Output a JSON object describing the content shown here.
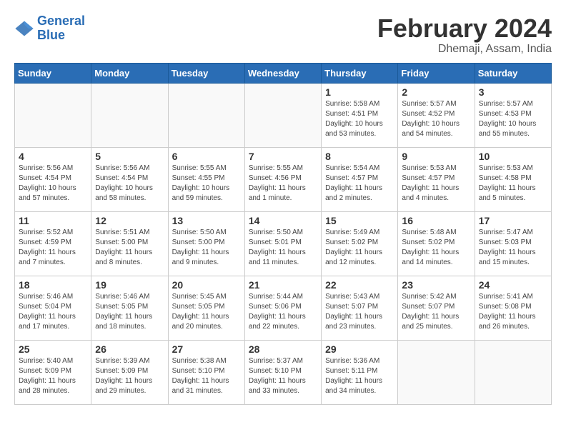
{
  "header": {
    "logo_line1": "General",
    "logo_line2": "Blue",
    "title": "February 2024",
    "subtitle": "Dhemaji, Assam, India"
  },
  "days_of_week": [
    "Sunday",
    "Monday",
    "Tuesday",
    "Wednesday",
    "Thursday",
    "Friday",
    "Saturday"
  ],
  "weeks": [
    [
      {
        "day": "",
        "info": ""
      },
      {
        "day": "",
        "info": ""
      },
      {
        "day": "",
        "info": ""
      },
      {
        "day": "",
        "info": ""
      },
      {
        "day": "1",
        "info": "Sunrise: 5:58 AM\nSunset: 4:51 PM\nDaylight: 10 hours\nand 53 minutes."
      },
      {
        "day": "2",
        "info": "Sunrise: 5:57 AM\nSunset: 4:52 PM\nDaylight: 10 hours\nand 54 minutes."
      },
      {
        "day": "3",
        "info": "Sunrise: 5:57 AM\nSunset: 4:53 PM\nDaylight: 10 hours\nand 55 minutes."
      }
    ],
    [
      {
        "day": "4",
        "info": "Sunrise: 5:56 AM\nSunset: 4:54 PM\nDaylight: 10 hours\nand 57 minutes."
      },
      {
        "day": "5",
        "info": "Sunrise: 5:56 AM\nSunset: 4:54 PM\nDaylight: 10 hours\nand 58 minutes."
      },
      {
        "day": "6",
        "info": "Sunrise: 5:55 AM\nSunset: 4:55 PM\nDaylight: 10 hours\nand 59 minutes."
      },
      {
        "day": "7",
        "info": "Sunrise: 5:55 AM\nSunset: 4:56 PM\nDaylight: 11 hours\nand 1 minute."
      },
      {
        "day": "8",
        "info": "Sunrise: 5:54 AM\nSunset: 4:57 PM\nDaylight: 11 hours\nand 2 minutes."
      },
      {
        "day": "9",
        "info": "Sunrise: 5:53 AM\nSunset: 4:57 PM\nDaylight: 11 hours\nand 4 minutes."
      },
      {
        "day": "10",
        "info": "Sunrise: 5:53 AM\nSunset: 4:58 PM\nDaylight: 11 hours\nand 5 minutes."
      }
    ],
    [
      {
        "day": "11",
        "info": "Sunrise: 5:52 AM\nSunset: 4:59 PM\nDaylight: 11 hours\nand 7 minutes."
      },
      {
        "day": "12",
        "info": "Sunrise: 5:51 AM\nSunset: 5:00 PM\nDaylight: 11 hours\nand 8 minutes."
      },
      {
        "day": "13",
        "info": "Sunrise: 5:50 AM\nSunset: 5:00 PM\nDaylight: 11 hours\nand 9 minutes."
      },
      {
        "day": "14",
        "info": "Sunrise: 5:50 AM\nSunset: 5:01 PM\nDaylight: 11 hours\nand 11 minutes."
      },
      {
        "day": "15",
        "info": "Sunrise: 5:49 AM\nSunset: 5:02 PM\nDaylight: 11 hours\nand 12 minutes."
      },
      {
        "day": "16",
        "info": "Sunrise: 5:48 AM\nSunset: 5:02 PM\nDaylight: 11 hours\nand 14 minutes."
      },
      {
        "day": "17",
        "info": "Sunrise: 5:47 AM\nSunset: 5:03 PM\nDaylight: 11 hours\nand 15 minutes."
      }
    ],
    [
      {
        "day": "18",
        "info": "Sunrise: 5:46 AM\nSunset: 5:04 PM\nDaylight: 11 hours\nand 17 minutes."
      },
      {
        "day": "19",
        "info": "Sunrise: 5:46 AM\nSunset: 5:05 PM\nDaylight: 11 hours\nand 18 minutes."
      },
      {
        "day": "20",
        "info": "Sunrise: 5:45 AM\nSunset: 5:05 PM\nDaylight: 11 hours\nand 20 minutes."
      },
      {
        "day": "21",
        "info": "Sunrise: 5:44 AM\nSunset: 5:06 PM\nDaylight: 11 hours\nand 22 minutes."
      },
      {
        "day": "22",
        "info": "Sunrise: 5:43 AM\nSunset: 5:07 PM\nDaylight: 11 hours\nand 23 minutes."
      },
      {
        "day": "23",
        "info": "Sunrise: 5:42 AM\nSunset: 5:07 PM\nDaylight: 11 hours\nand 25 minutes."
      },
      {
        "day": "24",
        "info": "Sunrise: 5:41 AM\nSunset: 5:08 PM\nDaylight: 11 hours\nand 26 minutes."
      }
    ],
    [
      {
        "day": "25",
        "info": "Sunrise: 5:40 AM\nSunset: 5:09 PM\nDaylight: 11 hours\nand 28 minutes."
      },
      {
        "day": "26",
        "info": "Sunrise: 5:39 AM\nSunset: 5:09 PM\nDaylight: 11 hours\nand 29 minutes."
      },
      {
        "day": "27",
        "info": "Sunrise: 5:38 AM\nSunset: 5:10 PM\nDaylight: 11 hours\nand 31 minutes."
      },
      {
        "day": "28",
        "info": "Sunrise: 5:37 AM\nSunset: 5:10 PM\nDaylight: 11 hours\nand 33 minutes."
      },
      {
        "day": "29",
        "info": "Sunrise: 5:36 AM\nSunset: 5:11 PM\nDaylight: 11 hours\nand 34 minutes."
      },
      {
        "day": "",
        "info": ""
      },
      {
        "day": "",
        "info": ""
      }
    ]
  ]
}
